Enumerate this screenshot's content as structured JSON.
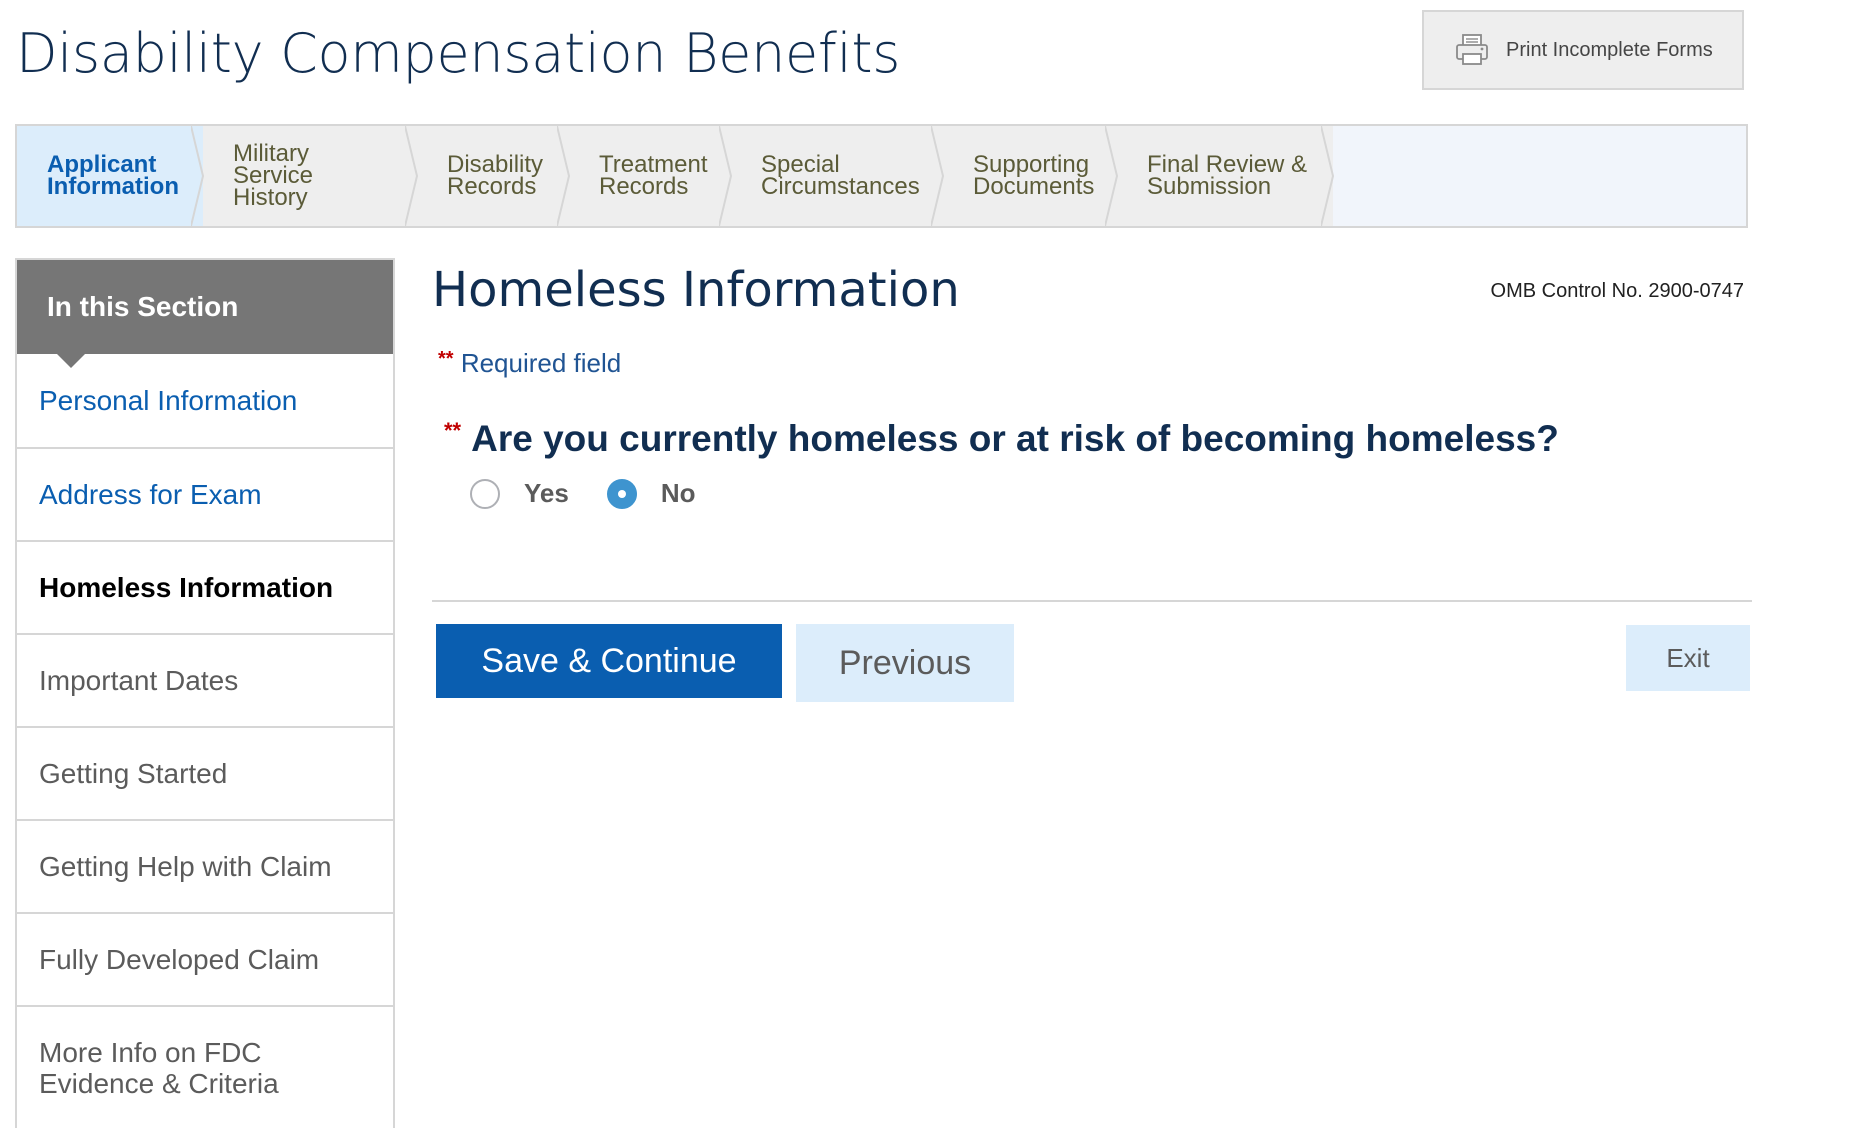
{
  "header": {
    "title": "Disability Compensation Benefits",
    "print_label": "Print Incomplete Forms",
    "print_icon": "printer-icon"
  },
  "steps": [
    {
      "label": "Applicant\nInformation",
      "active": true
    },
    {
      "label": "Military Service\nHistory",
      "active": false
    },
    {
      "label": "Disability\nRecords",
      "active": false
    },
    {
      "label": "Treatment\nRecords",
      "active": false
    },
    {
      "label": "Special\nCircumstances",
      "active": false
    },
    {
      "label": "Supporting\nDocuments",
      "active": false
    },
    {
      "label": "Final Review &\nSubmission",
      "active": false
    }
  ],
  "sidebar": {
    "heading": "In this Section",
    "items": [
      {
        "label": "Personal Information",
        "state": "link"
      },
      {
        "label": "Address for Exam",
        "state": "link"
      },
      {
        "label": "Homeless Information",
        "state": "current"
      },
      {
        "label": "Important Dates",
        "state": "default"
      },
      {
        "label": "Getting Started",
        "state": "default"
      },
      {
        "label": "Getting Help with Claim",
        "state": "default"
      },
      {
        "label": "Fully Developed Claim",
        "state": "default"
      },
      {
        "label": "More Info on FDC\nEvidence & Criteria",
        "state": "default"
      }
    ]
  },
  "main": {
    "title": "Homeless Information",
    "omb": "OMB Control No. 2900-0747",
    "required_stars": "**",
    "required_note": "Required field",
    "question": "Are you currently homeless or at risk of becoming homeless?",
    "options": [
      {
        "label": "Yes",
        "selected": false
      },
      {
        "label": "No",
        "selected": true
      }
    ]
  },
  "actions": {
    "save": "Save & Continue",
    "previous": "Previous",
    "exit": "Exit"
  },
  "colors": {
    "primary": "#0a5eb0",
    "title": "#112e51",
    "active_step_bg": "#dcedfb",
    "required": "#c00000",
    "radio_selected": "#3e94cf"
  }
}
